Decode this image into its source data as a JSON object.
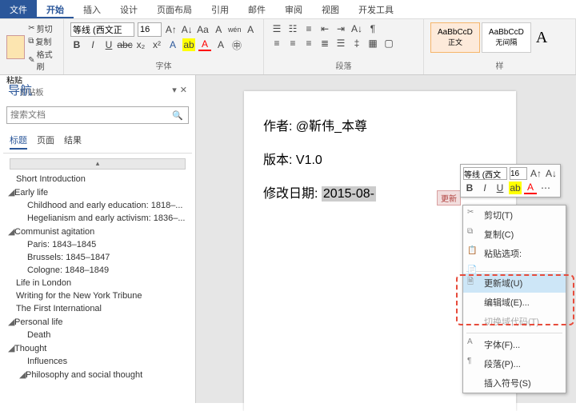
{
  "menubar": {
    "file": "文件",
    "tabs": [
      "开始",
      "插入",
      "设计",
      "页面布局",
      "引用",
      "邮件",
      "审阅",
      "视图",
      "开发工具"
    ]
  },
  "ribbon": {
    "clipboard": {
      "label": "剪贴板",
      "cut": "剪切",
      "copy": "复制",
      "paste": "粘贴",
      "format": "格式刷"
    },
    "font": {
      "label": "字体",
      "family": "等线 (西文正",
      "size": "16",
      "btns_row1": [
        "A",
        "A",
        "Aa",
        "A"
      ],
      "btns_row2": [
        "B",
        "I",
        "U",
        "abc",
        "x₂",
        "x²",
        "A",
        "A"
      ]
    },
    "paragraph": {
      "label": "段落"
    },
    "styles": {
      "label": "样",
      "items": [
        {
          "preview": "AaBbCcD",
          "name": "正文",
          "active": true
        },
        {
          "preview": "AaBbCcD",
          "name": "无间隔",
          "active": false
        }
      ]
    }
  },
  "nav": {
    "title": "导航",
    "search_placeholder": "搜索文档",
    "tabs": [
      "标题",
      "页面",
      "结果"
    ],
    "items": [
      {
        "level": 0,
        "caret": "",
        "text": "Short Introduction"
      },
      {
        "level": 0,
        "caret": "◢",
        "text": "Early life"
      },
      {
        "level": 1,
        "caret": "",
        "text": "Childhood and early education: 1818–..."
      },
      {
        "level": 1,
        "caret": "",
        "text": "Hegelianism and early activism: 1836–..."
      },
      {
        "level": 0,
        "caret": "◢",
        "text": "Communist agitation"
      },
      {
        "level": 1,
        "caret": "",
        "text": "Paris: 1843–1845"
      },
      {
        "level": 1,
        "caret": "",
        "text": "Brussels: 1845–1847"
      },
      {
        "level": 1,
        "caret": "",
        "text": "Cologne: 1848–1849"
      },
      {
        "level": 0,
        "caret": "",
        "text": "Life in London"
      },
      {
        "level": 0,
        "caret": "",
        "text": "Writing for the New York Tribune"
      },
      {
        "level": 0,
        "caret": "",
        "text": "The First International"
      },
      {
        "level": 0,
        "caret": "◢",
        "text": "Personal life"
      },
      {
        "level": 1,
        "caret": "",
        "text": "Death"
      },
      {
        "level": 0,
        "caret": "◢",
        "text": "Thought"
      },
      {
        "level": 1,
        "caret": "",
        "text": "Influences"
      },
      {
        "level": 1,
        "caret": "◢",
        "text": "Philosophy and social thought"
      }
    ]
  },
  "doc": {
    "author_line": "作者: @靳伟_本尊",
    "version_line": "版本: V1.0",
    "date_label": "修改日期: ",
    "date_value": "2015-08-"
  },
  "update_tag": "更新",
  "mini_toolbar": {
    "font": "等线 (西文",
    "size": "16",
    "row2": [
      "B",
      "I",
      "U",
      "aᵇ",
      "A",
      "▾"
    ]
  },
  "context_menu": {
    "items": [
      {
        "icon": "✂",
        "label": "剪切(T)",
        "state": ""
      },
      {
        "icon": "⧉",
        "label": "复制(C)",
        "state": ""
      },
      {
        "icon": "📋",
        "label": "粘贴选项:",
        "state": ""
      },
      {
        "icon": "📄",
        "label": "",
        "state": "icon-only"
      },
      {
        "icon": "🗎",
        "label": "更新域(U)",
        "state": "hover"
      },
      {
        "icon": "",
        "label": "编辑域(E)...",
        "state": ""
      },
      {
        "icon": "",
        "label": "切换域代码(T)",
        "state": "disabled"
      },
      {
        "icon": "A",
        "label": "字体(F)...",
        "state": ""
      },
      {
        "icon": "¶",
        "label": "段落(P)...",
        "state": ""
      },
      {
        "icon": "",
        "label": "插入符号(S)",
        "state": ""
      }
    ]
  }
}
